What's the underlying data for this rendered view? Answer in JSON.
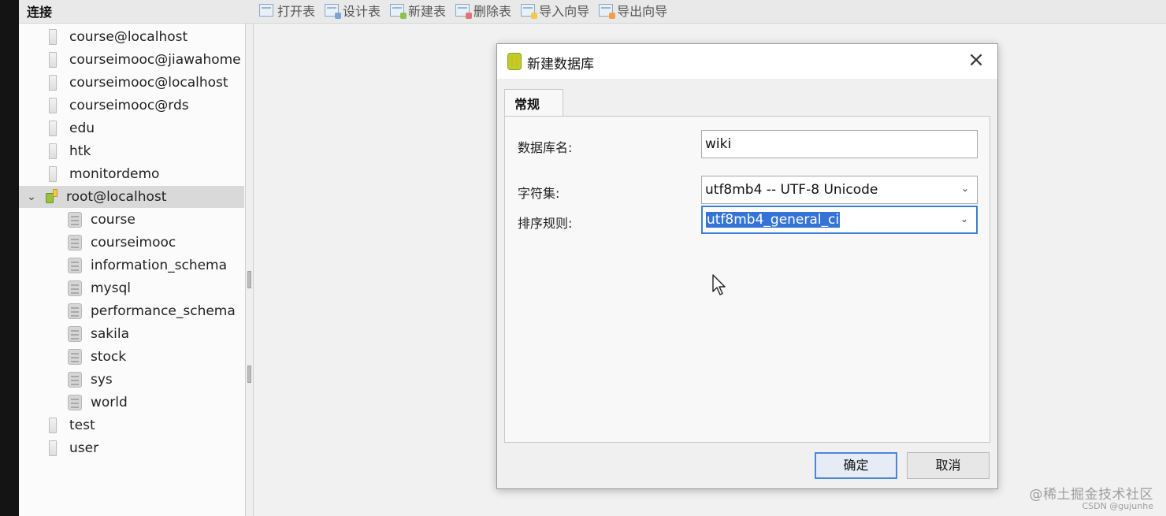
{
  "sidebar": {
    "title": "连接",
    "connections_before": [
      "course@localhost",
      "courseimooc@jiawahome",
      "courseimooc@localhost",
      "courseimooc@rds",
      "edu",
      "htk",
      "monitordemo"
    ],
    "active_connection": "root@localhost",
    "databases": [
      "course",
      "courseimooc",
      "information_schema",
      "mysql",
      "performance_schema",
      "sakila",
      "stock",
      "sys",
      "world"
    ],
    "connections_after": [
      "test",
      "user"
    ]
  },
  "toolbar": {
    "buttons": [
      "打开表",
      "设计表",
      "新建表",
      "删除表",
      "导入向导",
      "导出向导"
    ]
  },
  "dialog": {
    "title": "新建数据库",
    "tab": "常规",
    "fields": {
      "db_name_label": "数据库名:",
      "db_name_value": "wiki",
      "charset_label": "字符集:",
      "charset_value": "utf8mb4 -- UTF-8 Unicode",
      "collation_label": "排序规则:",
      "collation_value": "utf8mb4_general_ci"
    },
    "ok_label": "确定",
    "cancel_label": "取消"
  },
  "watermark": {
    "main": "@稀土掘金技术社区",
    "sub": "CSDN @gujunhe"
  },
  "colors": {
    "selection": "#3574d6",
    "focus_border": "#3c7fd6",
    "selected_row": "#d9d9d9"
  }
}
